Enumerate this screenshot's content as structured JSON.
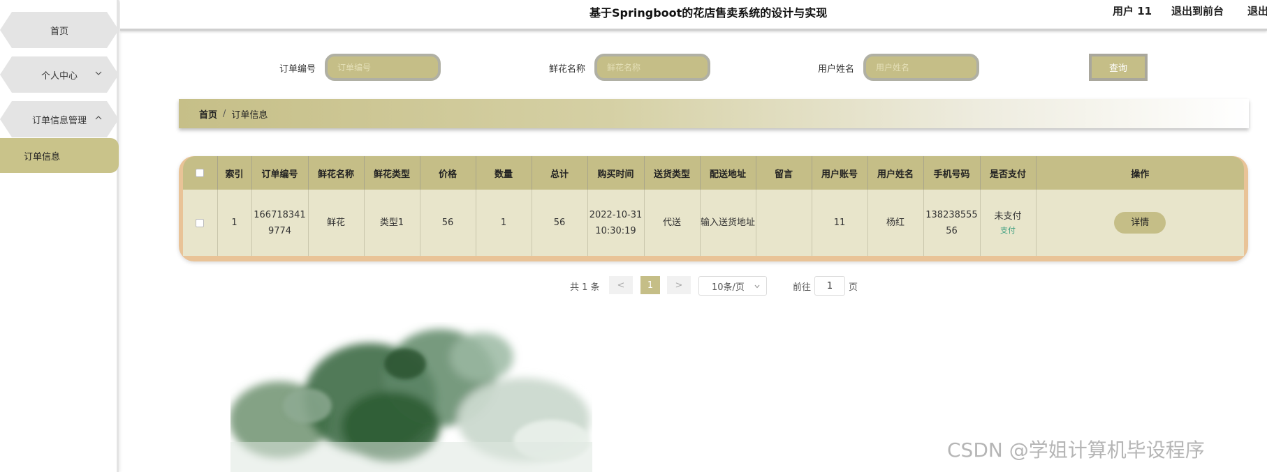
{
  "header": {
    "title": "基于Springboot的花店售卖系统的设计与实现",
    "user_label": "用户 11",
    "front_label": "退出到前台",
    "logout_label": "退出"
  },
  "sidebar": {
    "items": [
      {
        "label": "首页"
      },
      {
        "label": "个人中心"
      },
      {
        "label": "订单信息管理"
      }
    ],
    "sub_item": "订单信息"
  },
  "search": {
    "order_no_label": "订单编号",
    "order_no_placeholder": "订单编号",
    "flower_name_label": "鲜花名称",
    "flower_name_placeholder": "鲜花名称",
    "user_name_label": "用户姓名",
    "user_name_placeholder": "用户姓名",
    "query_label": "查询"
  },
  "breadcrumb": {
    "home": "首页",
    "separator": "/",
    "current": "订单信息"
  },
  "table": {
    "headers": [
      "索引",
      "订单编号",
      "鲜花名称",
      "鲜花类型",
      "价格",
      "数量",
      "总计",
      "购买时间",
      "送货类型",
      "配送地址",
      "留言",
      "用户账号",
      "用户姓名",
      "手机号码",
      "是否支付",
      "操作"
    ],
    "rows": [
      {
        "index": "1",
        "order_no": "1667183419774",
        "flower_name": "鲜花",
        "flower_type": "类型1",
        "price": "56",
        "quantity": "1",
        "total": "56",
        "purchase_time": "2022-10-31 10:30:19",
        "delivery_type": "代送",
        "address": "输入送货地址",
        "message": "",
        "account": "11",
        "user_name": "杨红",
        "phone": "13823855556",
        "paid_status": "未支付",
        "pay_link": "支付",
        "detail_label": "详情"
      }
    ]
  },
  "pagination": {
    "total": "共 1 条",
    "prev": "<",
    "current_page": "1",
    "next": ">",
    "page_size": "10条/页",
    "goto_label": "前往",
    "goto_value": "1",
    "page_suffix": "页"
  },
  "watermark": "CSDN @学姐计算机毕设程序",
  "colors": {
    "accent": "#c5be87",
    "table_border": "#e9c397",
    "pay_link": "#3e9f80"
  }
}
